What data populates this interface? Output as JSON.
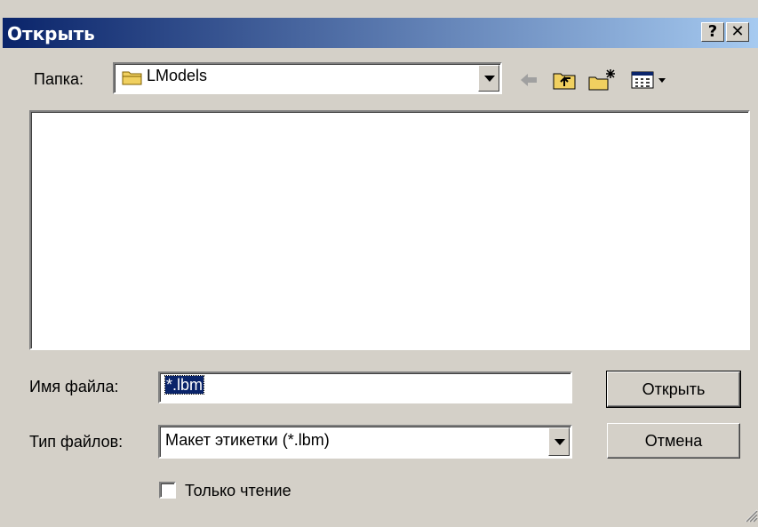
{
  "window": {
    "title": "Открыть",
    "help_label": "?",
    "close_label": "✕"
  },
  "folder": {
    "label": "Папка:",
    "current": "LModels"
  },
  "file_name": {
    "label": "Имя файла:",
    "value": "*.lbm"
  },
  "file_type": {
    "label": "Тип файлов:",
    "selected": "Макет этикетки (*.lbm)"
  },
  "buttons": {
    "open": "Открыть",
    "cancel": "Отмена"
  },
  "readonly": {
    "label": "Только чтение",
    "checked": false
  },
  "colors": {
    "title_start": "#0a246a",
    "title_end": "#a6caf0",
    "face": "#d4d0c8",
    "selection": "#0a246a"
  },
  "icons": {
    "folder": "folder-icon",
    "back": "back-arrow-icon",
    "up": "up-folder-icon",
    "new_folder": "new-folder-icon",
    "view": "view-menu-icon"
  }
}
